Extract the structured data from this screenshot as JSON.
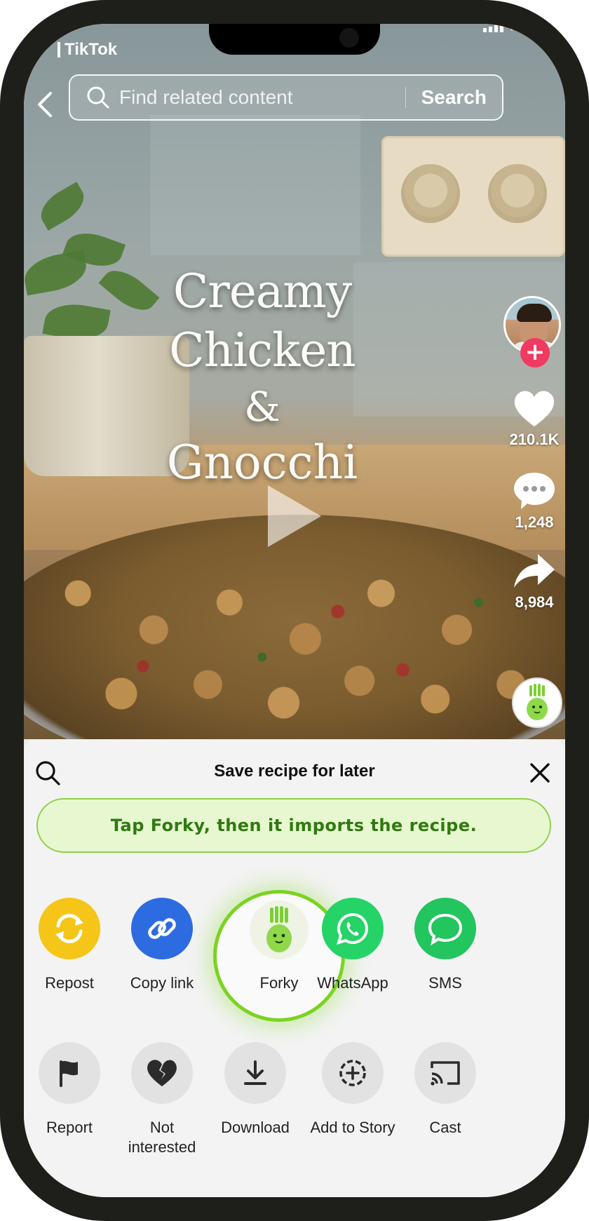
{
  "status_bar": {
    "app_label": "TikTok"
  },
  "search": {
    "placeholder": "Find related content",
    "button_label": "Search"
  },
  "video": {
    "title_line1": "Creamy Chicken",
    "title_line2": "&",
    "title_line3": "Gnocchi"
  },
  "rail": {
    "likes": "210.1K",
    "comments": "1,248",
    "shares": "8,984"
  },
  "share_sheet": {
    "title": "Save recipe for later",
    "tip": "Tap Forky, then it imports the recipe.",
    "share_targets": [
      {
        "label": "Repost",
        "icon": "repost-icon",
        "color": "#f5c518"
      },
      {
        "label": "Copy link",
        "icon": "link-icon",
        "color": "#2d6be0"
      },
      {
        "label": "Forky",
        "icon": "forky-icon",
        "color": "#7ad321"
      },
      {
        "label": "WhatsApp",
        "icon": "whatsapp-icon",
        "color": "#25d366"
      },
      {
        "label": "SMS",
        "icon": "sms-icon",
        "color": "#22c55e"
      }
    ],
    "actions": [
      {
        "label": "Report",
        "icon": "flag-icon"
      },
      {
        "label": "Not interested",
        "icon": "broken-heart-icon"
      },
      {
        "label": "Download",
        "icon": "download-icon"
      },
      {
        "label": "Add to Story",
        "icon": "add-story-icon"
      },
      {
        "label": "Cast",
        "icon": "cast-icon"
      }
    ]
  }
}
